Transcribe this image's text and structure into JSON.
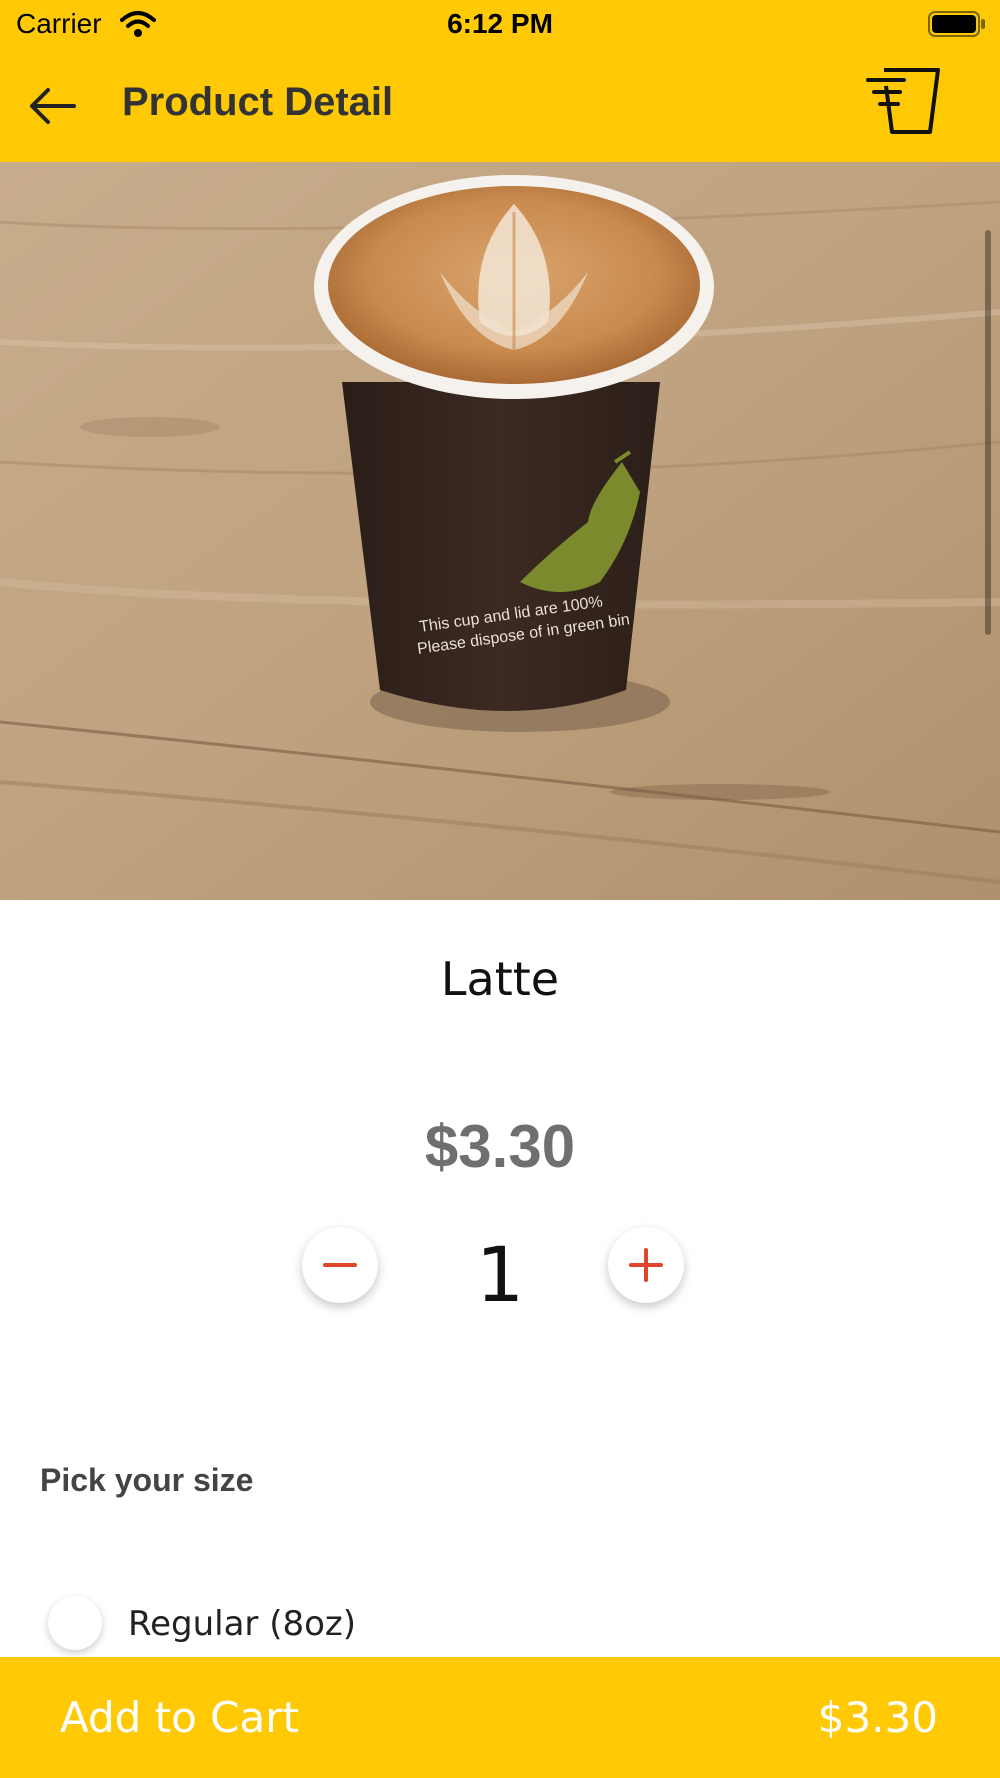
{
  "status_bar": {
    "carrier": "Carrier",
    "time": "6:12 PM"
  },
  "nav": {
    "title": "Product Detail",
    "back_icon": "arrow-left-icon",
    "cart_icon": "cart-icon"
  },
  "product": {
    "image_alt": "latte in brown paper cup on wooden table",
    "name": "Latte",
    "price": "$3.30",
    "quantity": "1"
  },
  "size": {
    "heading": "Pick your size",
    "options": [
      {
        "label": "Regular (8oz)",
        "selected": false
      }
    ]
  },
  "cart_bar": {
    "label": "Add to Cart",
    "total": "$3.30"
  },
  "colors": {
    "accent": "#FFCA05",
    "stepper": "#E0442A",
    "price": "#6f6f6f"
  }
}
